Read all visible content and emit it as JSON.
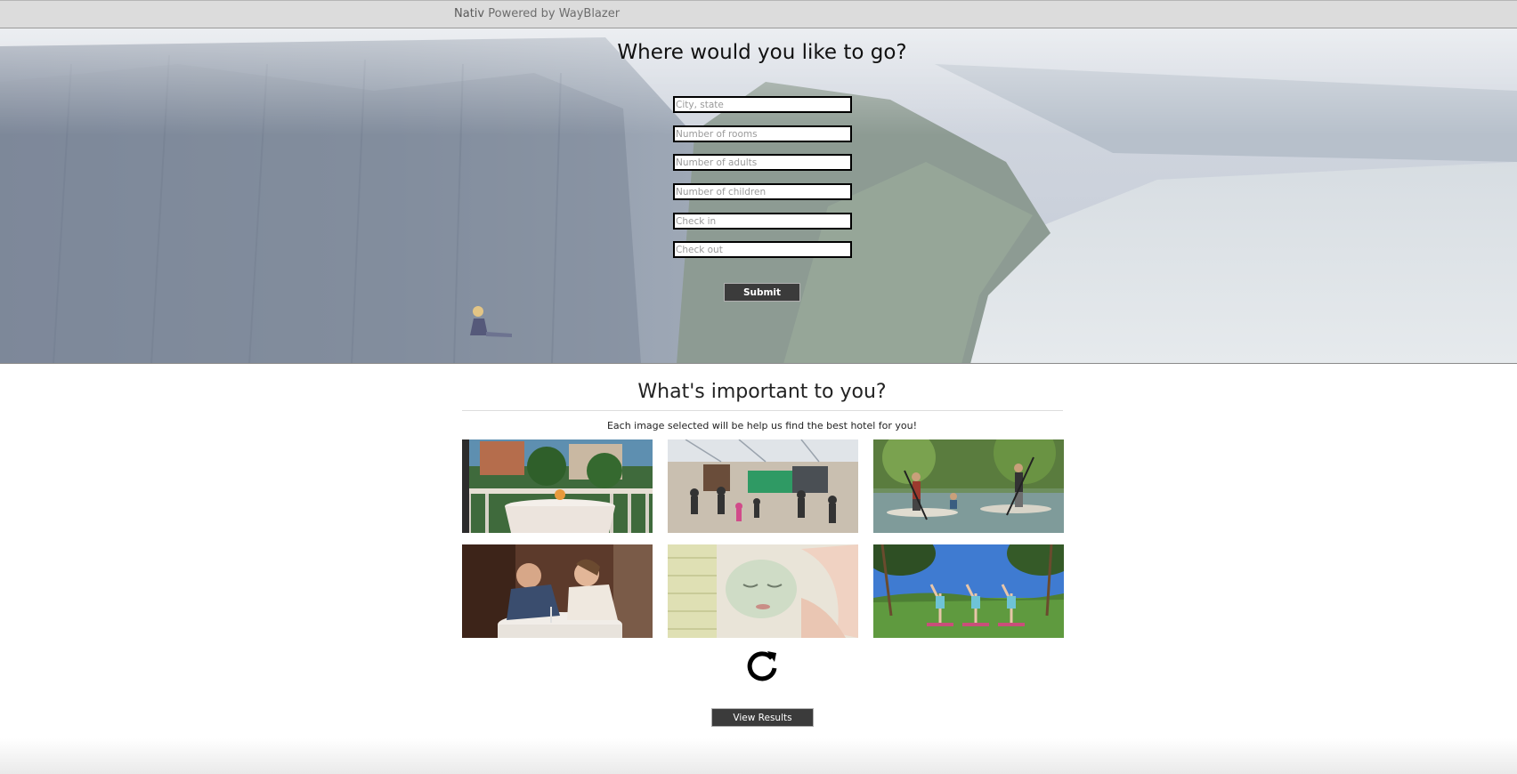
{
  "navbar": {
    "brand_name": "Nativ",
    "brand_tagline": "Powered by WayBlazer"
  },
  "hero": {
    "title": "Where would you like to go?",
    "fields": [
      {
        "placeholder": "City, state",
        "value": ""
      },
      {
        "placeholder": "Number of rooms",
        "value": ""
      },
      {
        "placeholder": "Number of adults",
        "value": ""
      },
      {
        "placeholder": "Number of children",
        "value": ""
      },
      {
        "placeholder": "Check in",
        "value": ""
      },
      {
        "placeholder": "Check out",
        "value": ""
      }
    ],
    "submit_label": "Submit"
  },
  "preferences": {
    "title": "What's important to you?",
    "subtitle": "Each image selected will be help us find the best hotel for you!",
    "images": [
      {
        "icon": "dining-terrace-image"
      },
      {
        "icon": "family-museum-image"
      },
      {
        "icon": "paddleboard-image"
      },
      {
        "icon": "romantic-dinner-image"
      },
      {
        "icon": "spa-facial-image"
      },
      {
        "icon": "outdoor-yoga-image"
      }
    ],
    "refresh_icon": "refresh-icon",
    "view_results_label": "View Results"
  }
}
